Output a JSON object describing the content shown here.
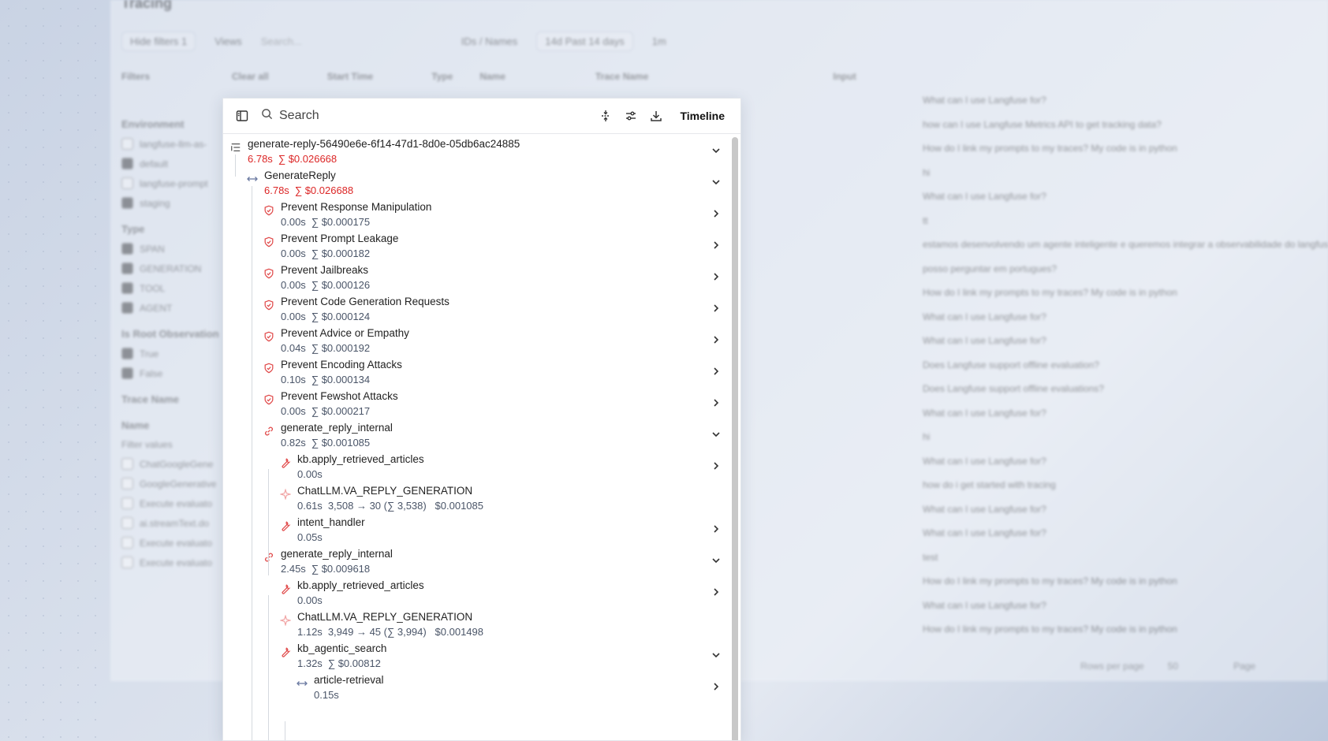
{
  "background_app": {
    "title": "Tracing",
    "toolbar": {
      "hide_filters": "Hide filters",
      "filter_count": "1",
      "views": "Views",
      "search_placeholder": "Search...",
      "ids_names": "IDs / Names",
      "range_short": "14d",
      "range_label": "Past 14 days",
      "refresh_interval": "1m"
    },
    "columns": [
      "Start Time",
      "Type",
      "Name",
      "Trace Name",
      "Input"
    ],
    "filters": {
      "title": "Filters",
      "clear_all": "Clear all",
      "environment": "Environment",
      "env_items": [
        {
          "label": "langfuse-llm-as-",
          "checked": false
        },
        {
          "label": "default",
          "checked": true
        },
        {
          "label": "langfuse-prompt",
          "checked": false
        },
        {
          "label": "staging",
          "checked": true
        }
      ],
      "type": "Type",
      "type_items": [
        {
          "label": "SPAN",
          "checked": true
        },
        {
          "label": "GENERATION",
          "checked": true
        },
        {
          "label": "TOOL",
          "checked": true
        },
        {
          "label": "AGENT",
          "checked": true
        }
      ],
      "is_root": "Is Root Observation",
      "root_items": [
        {
          "label": "True",
          "checked": true
        },
        {
          "label": "False",
          "checked": true
        }
      ],
      "trace_name": "Trace Name",
      "name": "Name",
      "filter_values": "Filter values",
      "name_items": [
        {
          "label": "ChatGoogleGene",
          "checked": false
        },
        {
          "label": "GoogleGenerative",
          "checked": false
        },
        {
          "label": "Execute evaluato",
          "checked": false
        },
        {
          "label": "ai.streamText.do",
          "checked": false
        },
        {
          "label": "Execute evaluato",
          "checked": false
        },
        {
          "label": "Execute evaluato",
          "checked": false
        }
      ]
    },
    "inputs": [
      "What can I use Langfuse for?",
      "how can I use Langfuse Metrics API to get tracking data?",
      "How do I link my prompts to my traces? My code is in python",
      "hi",
      "What can I use Langfuse for?",
      "tt",
      "estamos desenvolvendo um agente inteligente e queremos integrar a observabilidade do langfuse",
      "posso perguntar em portugues?",
      "How do I link my prompts to my traces? My code is in python",
      "What can I use Langfuse for?",
      "What can I use Langfuse for?",
      "Does Langfuse support offline evaluation?",
      "Does Langfuse support offline evaluations?",
      "What can I use Langfuse for?",
      "hi",
      "What can I use Langfuse for?",
      "how do i get started with tracing",
      "What can I use Langfuse for?",
      "What can I use Langfuse for?",
      "test",
      "How do I link my prompts to my traces? My code is in python",
      "What can I use Langfuse for?",
      "How do I link my prompts to my traces? My code is in python"
    ],
    "pager": {
      "rows_per_page": "Rows per page",
      "rows_value": "50",
      "page": "Page"
    }
  },
  "panel": {
    "search_placeholder": "Search",
    "timeline_label": "Timeline",
    "nodes": [
      {
        "id": "n0",
        "name": "generate-reply-56490e6e-6f14-47d1-8d0e-05db6ac24885",
        "duration": "6.78s",
        "cost": "∑ $0.026668",
        "icon": "trace-icon",
        "level": 0,
        "chevron": "down",
        "red": true
      },
      {
        "id": "n1",
        "name": "GenerateReply",
        "duration": "6.78s",
        "cost": "∑ $0.026688",
        "icon": "span-icon",
        "level": 1,
        "chevron": "down",
        "red": true
      },
      {
        "id": "n2",
        "name": "Prevent Response Manipulation",
        "duration": "0.00s",
        "cost": "∑ $0.000175",
        "icon": "shield-icon",
        "level": 2,
        "chevron": "right"
      },
      {
        "id": "n3",
        "name": "Prevent Prompt Leakage",
        "duration": "0.00s",
        "cost": "∑ $0.000182",
        "icon": "shield-icon",
        "level": 2,
        "chevron": "right"
      },
      {
        "id": "n4",
        "name": "Prevent Jailbreaks",
        "duration": "0.00s",
        "cost": "∑ $0.000126",
        "icon": "shield-icon",
        "level": 2,
        "chevron": "right"
      },
      {
        "id": "n5",
        "name": "Prevent Code Generation Requests",
        "duration": "0.00s",
        "cost": "∑ $0.000124",
        "icon": "shield-icon",
        "level": 2,
        "chevron": "right"
      },
      {
        "id": "n6",
        "name": "Prevent Advice or Empathy",
        "duration": "0.04s",
        "cost": "∑ $0.000192",
        "icon": "shield-icon",
        "level": 2,
        "chevron": "right"
      },
      {
        "id": "n7",
        "name": "Prevent Encoding Attacks",
        "duration": "0.10s",
        "cost": "∑ $0.000134",
        "icon": "shield-icon",
        "level": 2,
        "chevron": "right"
      },
      {
        "id": "n8",
        "name": "Prevent Fewshot Attacks",
        "duration": "0.00s",
        "cost": "∑ $0.000217",
        "icon": "shield-icon",
        "level": 2,
        "chevron": "right"
      },
      {
        "id": "n9",
        "name": "generate_reply_internal",
        "duration": "0.82s",
        "cost": "∑ $0.001085",
        "icon": "link-icon",
        "level": 2,
        "chevron": "down"
      },
      {
        "id": "n10",
        "name": "kb.apply_retrieved_articles",
        "duration": "0.00s",
        "cost": "",
        "icon": "tool-icon",
        "level": 3,
        "chevron": "right"
      },
      {
        "id": "n11",
        "name": "ChatLLM.VA_REPLY_GENERATION",
        "duration": "0.61s",
        "cost": "3,508 → 30 (∑ 3,538)   $0.001085",
        "icon": "generation-icon",
        "level": 3,
        "chevron": ""
      },
      {
        "id": "n12",
        "name": "intent_handler",
        "duration": "0.05s",
        "cost": "",
        "icon": "tool-icon",
        "level": 3,
        "chevron": "right"
      },
      {
        "id": "n13",
        "name": "generate_reply_internal",
        "duration": "2.45s",
        "cost": "∑ $0.009618",
        "icon": "link-icon",
        "level": 2,
        "chevron": "down"
      },
      {
        "id": "n14",
        "name": "kb.apply_retrieved_articles",
        "duration": "0.00s",
        "cost": "",
        "icon": "tool-icon",
        "level": 3,
        "chevron": "right"
      },
      {
        "id": "n15",
        "name": "ChatLLM.VA_REPLY_GENERATION",
        "duration": "1.12s",
        "cost": "3,949 → 45 (∑ 3,994)   $0.001498",
        "icon": "generation-icon",
        "level": 3,
        "chevron": ""
      },
      {
        "id": "n16",
        "name": "kb_agentic_search",
        "duration": "1.32s",
        "cost": "∑ $0.00812",
        "icon": "tool-icon",
        "level": 3,
        "chevron": "down"
      },
      {
        "id": "n17",
        "name": "article-retrieval",
        "duration": "0.15s",
        "cost": "",
        "icon": "span-icon",
        "level": 4,
        "chevron": "right"
      }
    ]
  }
}
